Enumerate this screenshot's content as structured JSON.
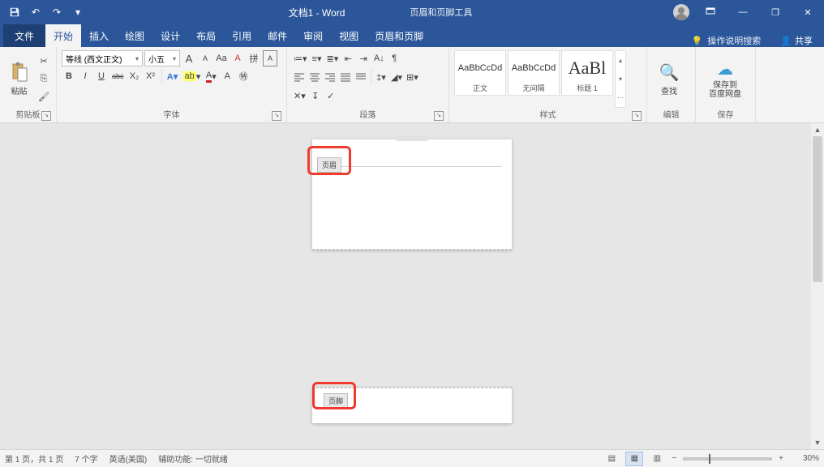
{
  "titlebar": {
    "doc_title": "文档1 - Word",
    "context_tool": "页眉和页脚工具"
  },
  "qat": {
    "save": "保存",
    "undo": "撤消",
    "redo": "恢复"
  },
  "win": {
    "min": "最小化",
    "max": "还原",
    "close": "关闭"
  },
  "tabs": {
    "file": "文件",
    "items": [
      "开始",
      "插入",
      "绘图",
      "设计",
      "布局",
      "引用",
      "邮件",
      "审阅",
      "视图",
      "页眉页脚",
      "页眉和页脚"
    ],
    "active_index": 0,
    "tell_me": "操作说明搜索",
    "share": "共享"
  },
  "ribbon": {
    "clipboard": {
      "label": "剪贴板",
      "paste": "粘贴"
    },
    "font": {
      "label": "字体",
      "font_name": "等线 (西文正文)",
      "font_size": "小五",
      "bold": "B",
      "italic": "I",
      "underline": "U",
      "strike": "abc",
      "sub": "X₂",
      "sup": "X²",
      "grow": "A",
      "shrink": "A",
      "case": "Aa",
      "clear": "A",
      "phonetic": "拼",
      "border": "A",
      "highlight": "ab",
      "font_color": "A"
    },
    "paragraph": {
      "label": "段落",
      "bullets": "•",
      "numbering": "1",
      "multilist": "≡",
      "dec_indent": "⇤",
      "inc_indent": "⇥",
      "sort": "↧",
      "show_marks": "¶",
      "align_l": "≡",
      "align_c": "≡",
      "align_r": "≡",
      "align_j": "≡",
      "line_spacing": "↕",
      "shading": "▦",
      "borders": "⊞"
    },
    "styles": {
      "label": "样式",
      "items": [
        {
          "preview": "AaBbCcDd",
          "name": "正文"
        },
        {
          "preview": "AaBbCcDd",
          "name": "无间隔"
        },
        {
          "preview": "AaBl",
          "name": "标题 1",
          "big": true
        }
      ]
    },
    "editing": {
      "label": "编辑",
      "find": "查找"
    },
    "save_group": {
      "label": "保存",
      "save_to": "保存到\n百度网盘"
    }
  },
  "document": {
    "header_tag": "页眉",
    "footer_tag": "页脚"
  },
  "statusbar": {
    "page": "第 1 页，共 1 页",
    "words": "7 个字",
    "lang": "英语(美国)",
    "accessibility": "辅助功能: 一切就绪",
    "zoom": "30%"
  }
}
